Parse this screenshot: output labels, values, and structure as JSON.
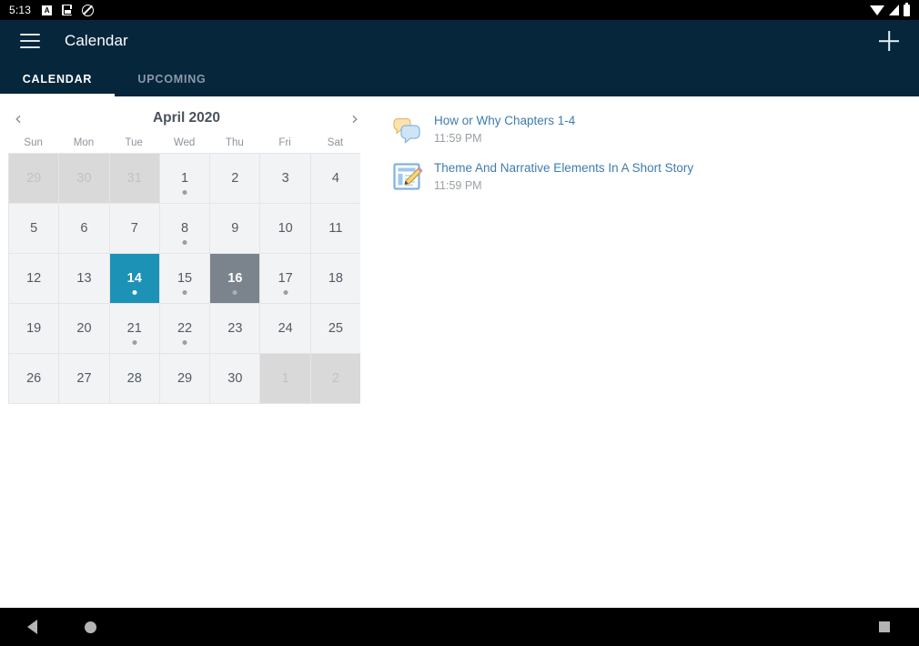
{
  "statusbar": {
    "clock": "5:13",
    "icons_left": [
      "alarm-icon",
      "sd-card-icon",
      "do-not-disturb-icon"
    ],
    "icons_right": [
      "wifi-icon",
      "cell-signal-icon",
      "battery-icon"
    ]
  },
  "appbar": {
    "menu_icon": "hamburger-menu-icon",
    "title": "Calendar",
    "add_icon": "plus-icon",
    "tabs": [
      {
        "label": "CALENDAR",
        "active": true
      },
      {
        "label": "UPCOMING",
        "active": false
      }
    ]
  },
  "calendar": {
    "prev_label": "‹",
    "next_label": "›",
    "month": "April 2020",
    "weekdays": [
      "Sun",
      "Mon",
      "Tue",
      "Wed",
      "Thu",
      "Fri",
      "Sat"
    ],
    "days": [
      {
        "num": "29",
        "state": "out",
        "dot": false
      },
      {
        "num": "30",
        "state": "out",
        "dot": false
      },
      {
        "num": "31",
        "state": "out",
        "dot": false
      },
      {
        "num": "1",
        "state": "in",
        "dot": true
      },
      {
        "num": "2",
        "state": "in",
        "dot": false
      },
      {
        "num": "3",
        "state": "in",
        "dot": false
      },
      {
        "num": "4",
        "state": "in",
        "dot": false
      },
      {
        "num": "5",
        "state": "in",
        "dot": false
      },
      {
        "num": "6",
        "state": "in",
        "dot": false
      },
      {
        "num": "7",
        "state": "in",
        "dot": false
      },
      {
        "num": "8",
        "state": "in",
        "dot": true
      },
      {
        "num": "9",
        "state": "in",
        "dot": false
      },
      {
        "num": "10",
        "state": "in",
        "dot": false
      },
      {
        "num": "11",
        "state": "in",
        "dot": false
      },
      {
        "num": "12",
        "state": "in",
        "dot": false
      },
      {
        "num": "13",
        "state": "in",
        "dot": false
      },
      {
        "num": "14",
        "state": "selected",
        "dot": true
      },
      {
        "num": "15",
        "state": "in",
        "dot": true
      },
      {
        "num": "16",
        "state": "today",
        "dot": true
      },
      {
        "num": "17",
        "state": "in",
        "dot": true
      },
      {
        "num": "18",
        "state": "in",
        "dot": false
      },
      {
        "num": "19",
        "state": "in",
        "dot": false
      },
      {
        "num": "20",
        "state": "in",
        "dot": false
      },
      {
        "num": "21",
        "state": "in",
        "dot": true
      },
      {
        "num": "22",
        "state": "in",
        "dot": true
      },
      {
        "num": "23",
        "state": "in",
        "dot": false
      },
      {
        "num": "24",
        "state": "in",
        "dot": false
      },
      {
        "num": "25",
        "state": "in",
        "dot": false
      },
      {
        "num": "26",
        "state": "in",
        "dot": false
      },
      {
        "num": "27",
        "state": "in",
        "dot": false
      },
      {
        "num": "28",
        "state": "in",
        "dot": false
      },
      {
        "num": "29",
        "state": "in",
        "dot": false
      },
      {
        "num": "30",
        "state": "in",
        "dot": false
      },
      {
        "num": "1",
        "state": "out",
        "dot": false
      },
      {
        "num": "2",
        "state": "out",
        "dot": false
      }
    ],
    "selected_color": "#1d92b7",
    "today_color": "#7b838d"
  },
  "events": [
    {
      "icon": "discussion-bubbles-icon",
      "title": "How or Why Chapters 1-4",
      "time": "11:59 PM"
    },
    {
      "icon": "assignment-pencil-icon",
      "title": "Theme And Narrative Elements In A Short Story",
      "time": "11:59 PM"
    }
  ],
  "navbar": {
    "back_icon": "back-triangle-icon",
    "home_icon": "home-circle-icon",
    "recents_icon": "recents-square-icon"
  }
}
